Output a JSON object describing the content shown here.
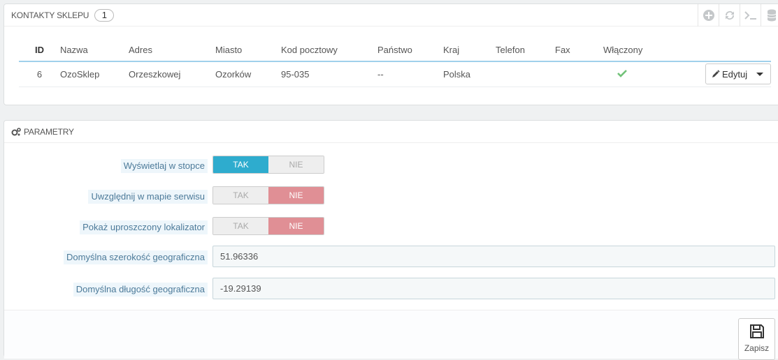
{
  "contacts_panel": {
    "title": "KONTAKTY SKLEPU",
    "count": "1",
    "columns": [
      "ID",
      "Nazwa",
      "Adres",
      "Miasto",
      "Kod pocztowy",
      "Państwo",
      "Kraj",
      "Telefon",
      "Fax",
      "Włączony"
    ],
    "rows": [
      {
        "id": "6",
        "name": "OzoSklep",
        "address": "Orzeszkowej",
        "city": "Ozorków",
        "postcode": "95-035",
        "state": "--",
        "country": "Polska",
        "phone": "",
        "fax": "",
        "enabled_icon": "check-icon"
      }
    ],
    "edit_label": "Edytuj"
  },
  "params_panel": {
    "title": "PARAMETRY",
    "fields": {
      "footer": {
        "label": "Wyświetlaj w stopce",
        "yes": "TAK",
        "no": "NIE",
        "value": "yes"
      },
      "sitemap": {
        "label": "Uwzględnij w mapie serwisu",
        "yes": "TAK",
        "no": "NIE",
        "value": "no"
      },
      "simple_locator": {
        "label": "Pokaż uproszczony lokalizator",
        "yes": "TAK",
        "no": "NIE",
        "value": "no"
      },
      "latitude": {
        "label": "Domyślna szerokość geograficzna",
        "value": "51.96336"
      },
      "longitude": {
        "label": "Domyślna długość geograficzna",
        "value": "-19.29139"
      }
    },
    "save_label": "Zapisz"
  },
  "colors": {
    "accent": "#2eacce",
    "no_active": "#e08f95",
    "check": "#72c279"
  }
}
